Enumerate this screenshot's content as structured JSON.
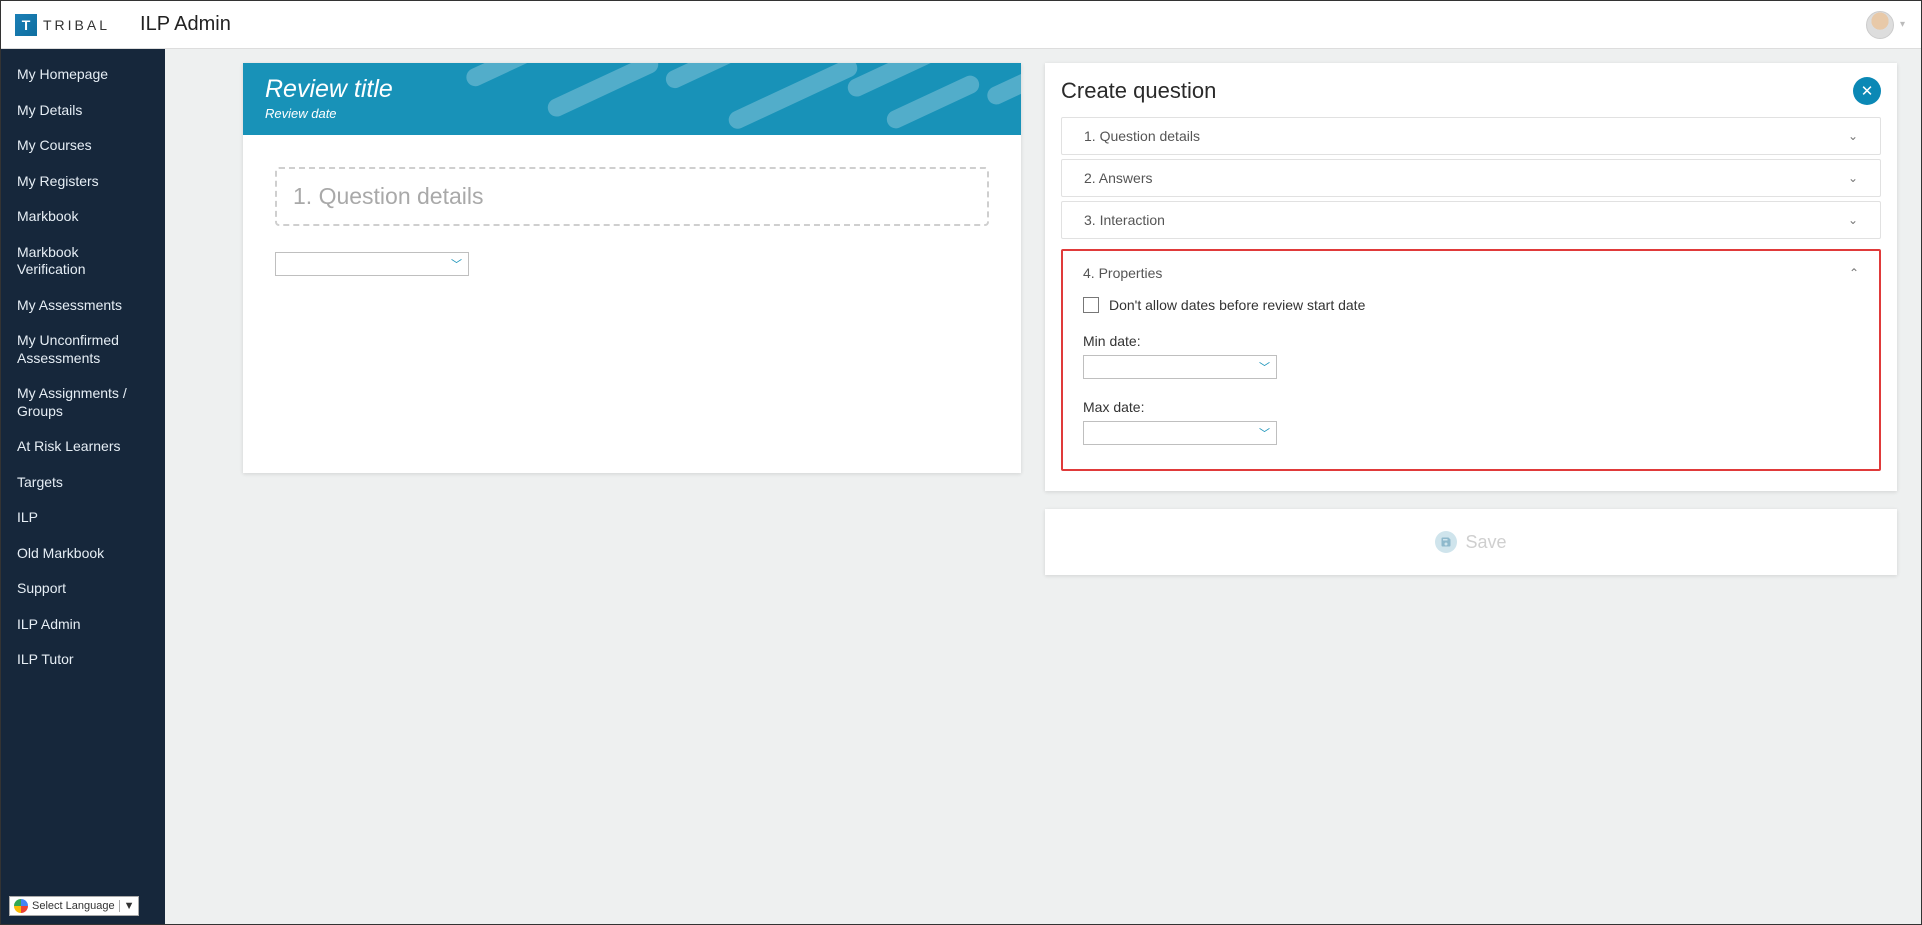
{
  "header": {
    "brand_letter": "T",
    "brand_text": "TRIBAL",
    "page_title": "ILP Admin"
  },
  "sidebar": {
    "items": [
      "My Homepage",
      "My Details",
      "My Courses",
      "My Registers",
      "Markbook",
      "Markbook Verification",
      "My Assessments",
      "My Unconfirmed Assessments",
      "My Assignments / Groups",
      "At Risk Learners",
      "Targets",
      "ILP",
      "Old Markbook",
      "Support",
      "ILP Admin",
      "ILP Tutor"
    ]
  },
  "lang_widget": {
    "label": "Select Language",
    "arrow": "▼"
  },
  "preview": {
    "title": "Review title",
    "date": "Review date",
    "question_placeholder": "1. Question details"
  },
  "right_panel": {
    "title": "Create question",
    "steps": [
      {
        "label": "1. Question details"
      },
      {
        "label": "2. Answers"
      },
      {
        "label": "3. Interaction"
      }
    ],
    "open_step": {
      "label": "4. Properties",
      "checkbox_label": "Don't allow dates before review start date",
      "min_date_label": "Min date:",
      "min_date_value": "",
      "max_date_label": "Max date:",
      "max_date_value": ""
    },
    "save_label": "Save"
  }
}
